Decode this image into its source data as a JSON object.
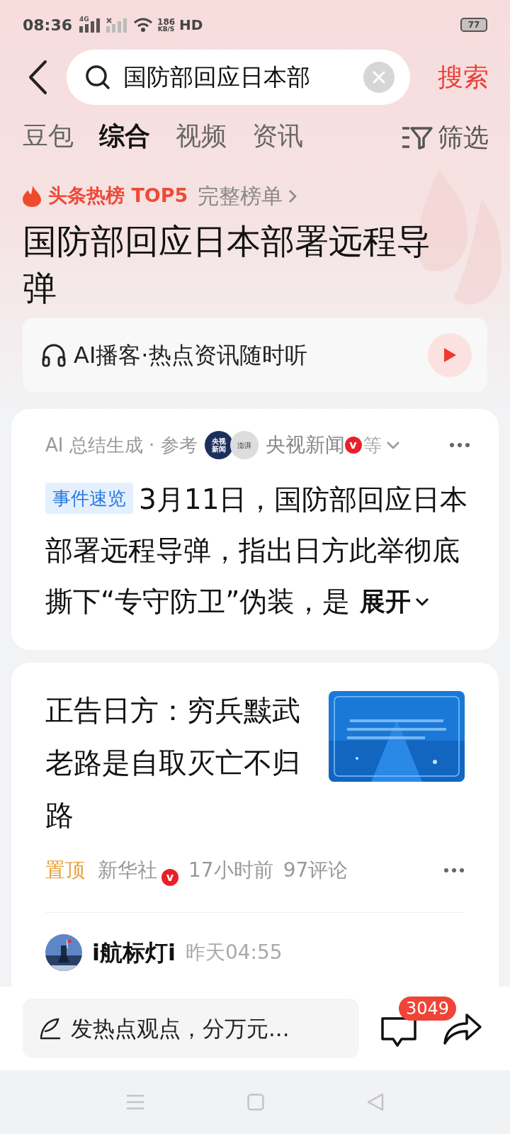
{
  "status_bar": {
    "time": "08:36",
    "sim1_label": "4G",
    "net_speed": "186",
    "net_unit": "KB/S",
    "hd": "HD",
    "battery": "77"
  },
  "search": {
    "value": "国防部回应日本部",
    "button": "搜索"
  },
  "tabs": [
    {
      "label": "豆包",
      "selected": false
    },
    {
      "label": "综合",
      "selected": true
    },
    {
      "label": "视频",
      "selected": false
    },
    {
      "label": "资讯",
      "selected": false
    }
  ],
  "filter": {
    "label": "筛选"
  },
  "hot": {
    "label": "头条热榜 TOP5",
    "link": "完整榜单"
  },
  "headline": "国防部回应日本部署远程导弹",
  "podcast": {
    "label": "AI播客·热点资讯随时听"
  },
  "summary": {
    "source_label": "AI 总结生成 · 参考",
    "logos": [
      {
        "text": "央视新闻",
        "kind": "dark"
      },
      {
        "text": "澎湃",
        "kind": "light"
      }
    ],
    "source_name": "央视新闻",
    "verified": true,
    "verified_badge": "v",
    "more": "等",
    "tag": "事件速览",
    "text": "3月11日，国防部回应日本部署远程导弹，指出日方此举彻底撕下“专守防卫”伪装，是",
    "expand": "展开"
  },
  "articles": [
    {
      "title": "正告日方：穷兵黩武老路是自取灭亡不归路",
      "pinned": "置顶",
      "source": "新华社",
      "verified": true,
      "verified_badge": "v",
      "time": "17小时前",
      "comments": "97评论"
    }
  ],
  "post": {
    "author": "i航标灯i",
    "time": "昨天04:55"
  },
  "bottom": {
    "placeholder": "发热点观点，分万元...",
    "comment_count": "3049"
  }
}
